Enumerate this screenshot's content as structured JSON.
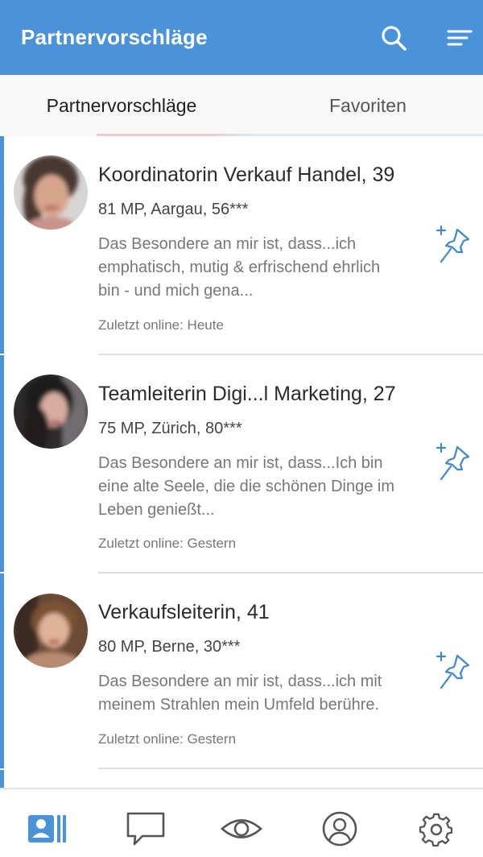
{
  "appbar": {
    "title": "Partnervorschläge",
    "search_icon": "search-icon",
    "menu_icon": "filter-menu-icon",
    "color": "#4a93d9"
  },
  "tabs": [
    {
      "label": "Partnervorschläge",
      "active": true
    },
    {
      "label": "Favoriten",
      "active": false
    }
  ],
  "cards": [
    {
      "title": "Koordinatorin Verkauf Handel, 39",
      "meta": "81 MP, Aargau, 56***",
      "desc_lines": [
        "Das Besondere an mir ist, dass...ich",
        "emphatisch, mutig & erfrischend ehrlich",
        "bin - und mich gena..."
      ],
      "online": "Zuletzt online: Heute"
    },
    {
      "title": "Teamleiterin Digi...l Marketing, 27",
      "meta": "75 MP, Zürich, 80***",
      "desc_lines": [
        "Das Besondere an mir ist, dass...Ich bin",
        "eine alte Seele, die die schönen Dinge im",
        "Leben genießt..."
      ],
      "online": "Zuletzt online: Gestern"
    },
    {
      "title": "Verkaufsleiterin, 41",
      "meta": "80 MP, Berne, 30***",
      "desc_lines": [
        "Das Besondere an mir ist, dass...ich mit",
        "meinem Strahlen mein Umfeld berühre."
      ],
      "online": "Zuletzt online: Gestern"
    }
  ],
  "bottom_nav": [
    {
      "icon": "suggestions-cards-icon",
      "active": true
    },
    {
      "icon": "chat-bubble-icon",
      "active": false
    },
    {
      "icon": "eye-icon",
      "active": false
    },
    {
      "icon": "profile-icon",
      "active": false
    },
    {
      "icon": "settings-gear-icon",
      "active": false
    }
  ]
}
